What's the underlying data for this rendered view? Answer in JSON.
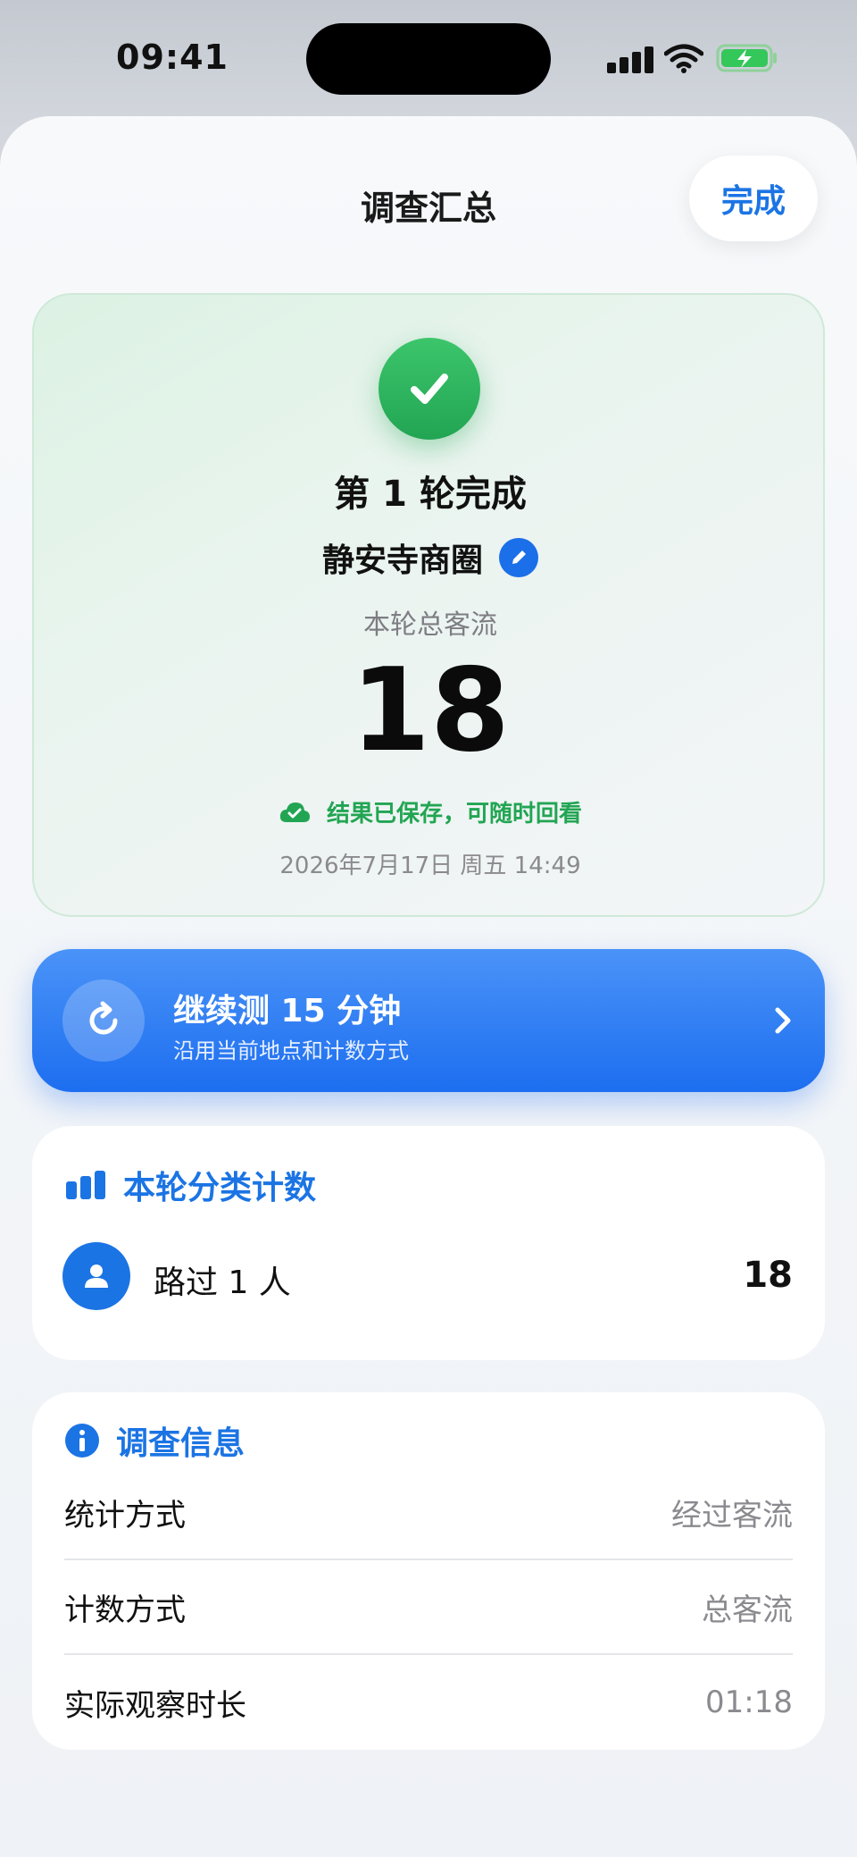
{
  "status_bar": {
    "time": "09:41"
  },
  "header": {
    "title": "调查汇总",
    "done_label": "完成"
  },
  "result": {
    "round_title": "第 1 轮完成",
    "location": "静安寺商圈",
    "total_label": "本轮总客流",
    "total_value": "18",
    "saved_text": "结果已保存，可随时回看",
    "date": "2026年7月17日 周五 14:49"
  },
  "continue": {
    "title": "继续测 15 分钟",
    "subtitle": "沿用当前地点和计数方式"
  },
  "category": {
    "heading": "本轮分类计数",
    "items": [
      {
        "label": "路过 1 人",
        "count": "18"
      }
    ]
  },
  "info": {
    "heading": "调查信息",
    "rows": [
      {
        "key": "统计方式",
        "value": "经过客流"
      },
      {
        "key": "计数方式",
        "value": "总客流"
      },
      {
        "key": "实际观察时长",
        "value": "01:18"
      }
    ]
  },
  "colors": {
    "accent": "#1b74e4",
    "success": "#22a553",
    "button_gradient_top": "#4a93f8",
    "button_gradient_bottom": "#1d6ef0"
  },
  "icons": {
    "status": [
      "signal-icon",
      "wifi-icon",
      "battery-charging-icon"
    ],
    "result": [
      "checkmark-icon",
      "pencil-icon",
      "cloud-check-icon"
    ],
    "continue": [
      "refresh-icon",
      "chevron-right-icon"
    ],
    "cards": [
      "bar-chart-icon",
      "person-icon",
      "info-icon"
    ]
  }
}
